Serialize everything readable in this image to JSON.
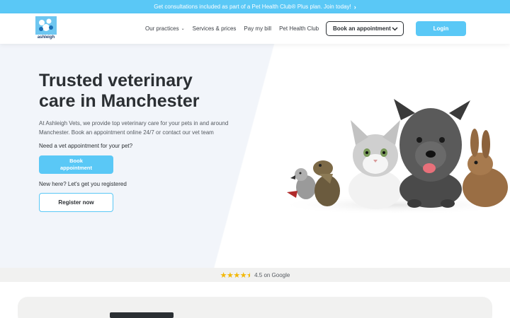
{
  "promo_banner": {
    "text": "Get consultations included as part of a Pet Health Club® Plus plan. Join today!",
    "chevron_icon": "chevron-right-icon"
  },
  "header": {
    "logo_text": "ashleigh",
    "nav": [
      {
        "label": "Our practices",
        "has_dropdown": true
      },
      {
        "label": "Services & prices"
      },
      {
        "label": "Pay my bill"
      },
      {
        "label": "Pet Health Club"
      }
    ],
    "book_appointment": "Book an appointment",
    "login": "Login"
  },
  "hero": {
    "title_line1": "Trusted veterinary",
    "title_line2": "care in Manchester",
    "intro": "At Ashleigh Vets, we provide top veterinary care for your pets in and around Manchester. Book an appointment online 24/7 or contact our vet team",
    "need_appointment": "Need a vet appointment for your pet?",
    "book_line1": "Book",
    "book_line2": "appointment",
    "new_here": "New here? Let's get you registered",
    "register": "Register now"
  },
  "rating": {
    "stars": 4.5,
    "text": "4.5 on Google"
  },
  "colors": {
    "accent": "#5ac8f6",
    "dark": "#2b2f33",
    "hero_bg": "#f2f5fa",
    "rating_bar": "#f1f1f0",
    "star": "#f2b705"
  }
}
